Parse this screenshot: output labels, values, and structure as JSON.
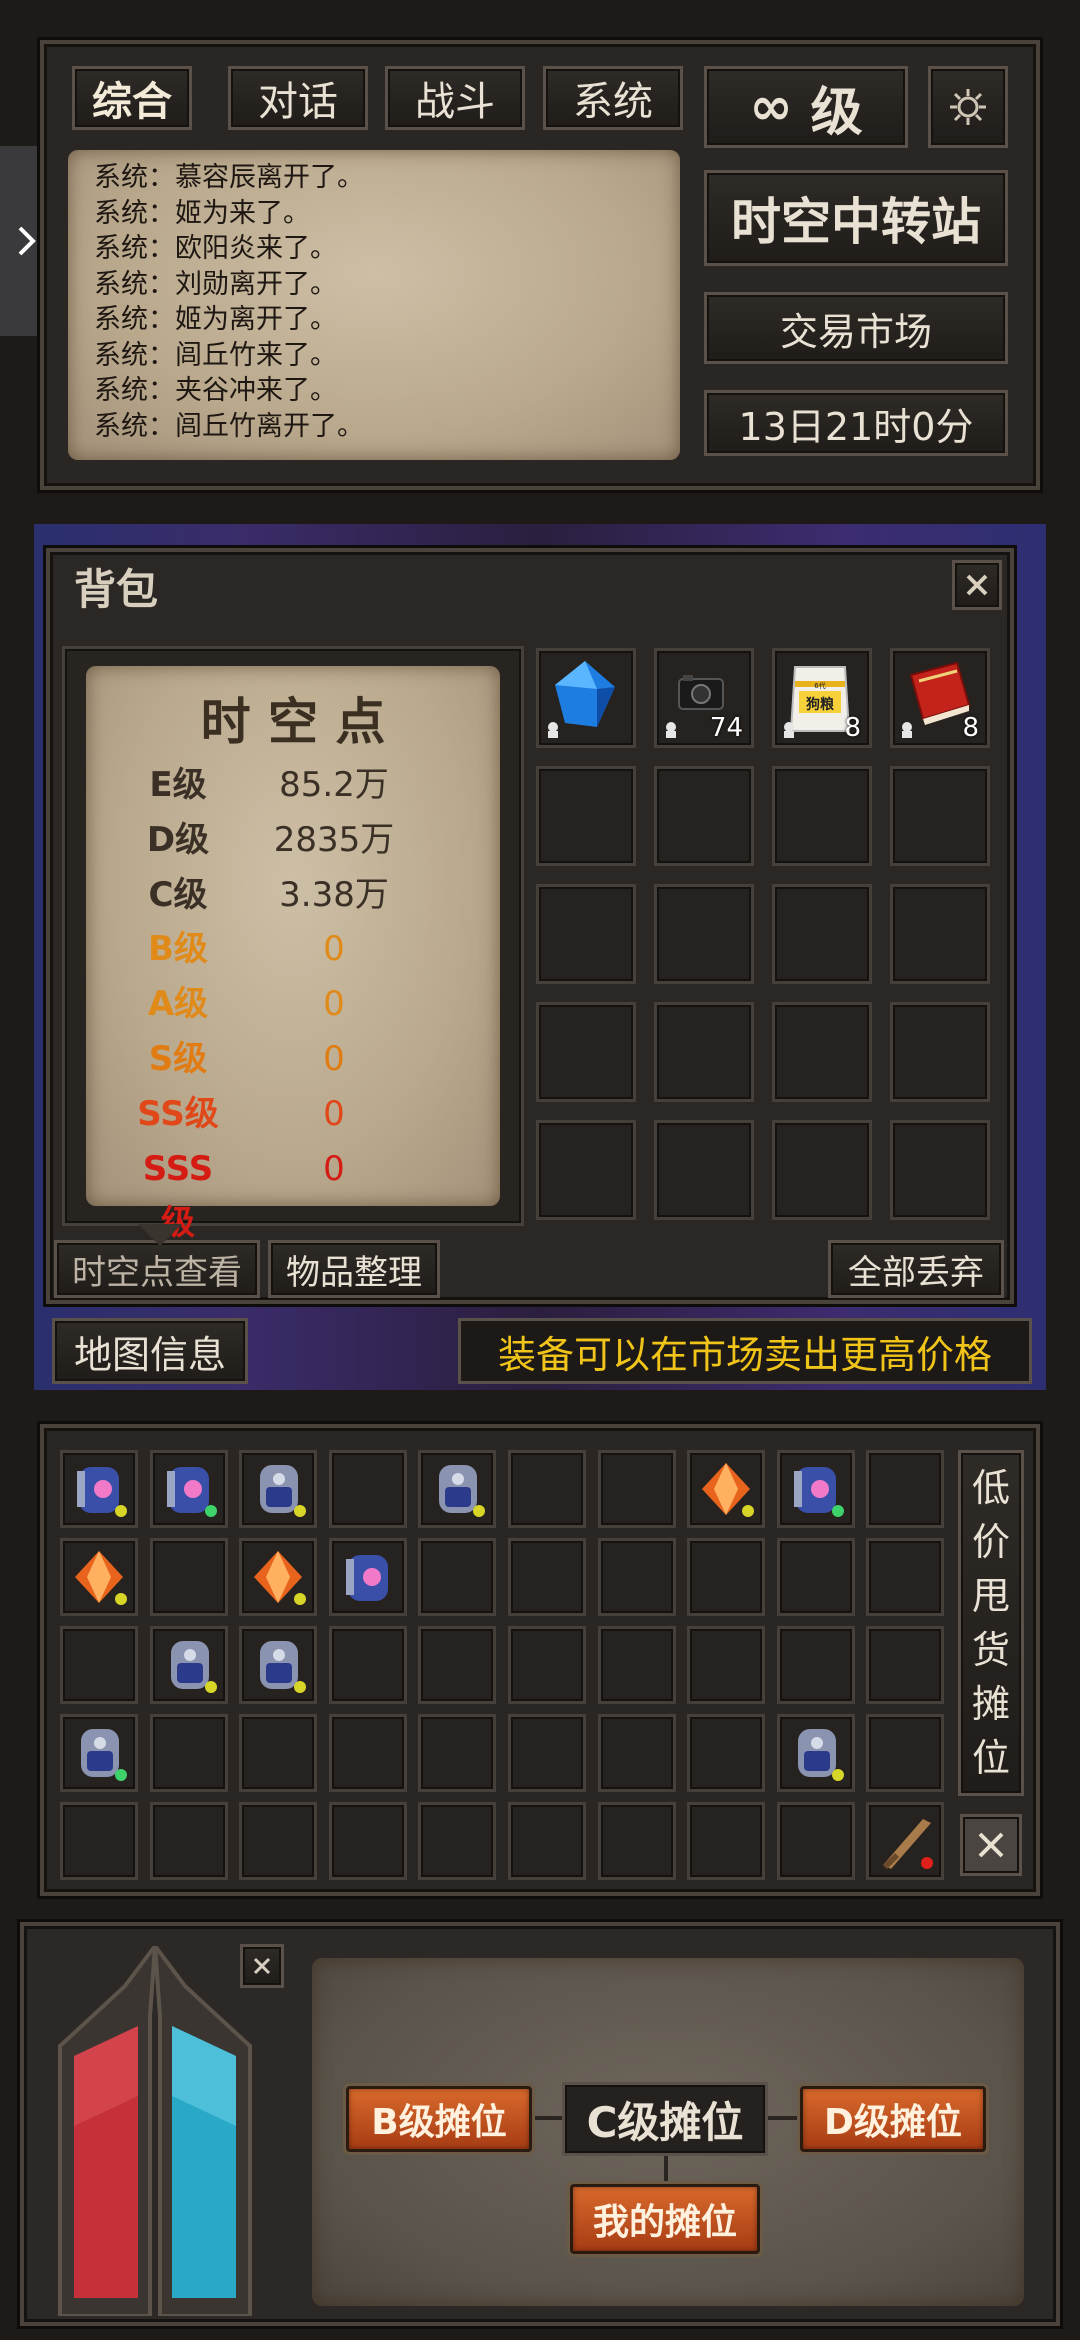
{
  "chat": {
    "tabs": [
      "综合",
      "对话",
      "战斗",
      "系统"
    ],
    "messages": [
      "系统：慕容辰离开了。",
      "系统：姬为来了。",
      "系统：欧阳炎来了。",
      "系统：刘勋离开了。",
      "系统：姬为离开了。",
      "系统：闾丘竹来了。",
      "系统：夹谷冲来了。",
      "系统：闾丘竹离开了。"
    ]
  },
  "hud": {
    "level_symbol": "∞",
    "level_label": "级",
    "location": "时空中转站",
    "market": "交易市场",
    "time": "13日21时0分"
  },
  "backpack": {
    "title": "背包",
    "points": {
      "title": "时 空 点",
      "rows": [
        {
          "grade": "E级",
          "value": "85.2万",
          "color": "#3a3026"
        },
        {
          "grade": "D级",
          "value": "2835万",
          "color": "#3a3026"
        },
        {
          "grade": "C级",
          "value": "3.38万",
          "color": "#3a3026"
        },
        {
          "grade": "B级",
          "value": "0",
          "color": "#e08a1a"
        },
        {
          "grade": "A级",
          "value": "0",
          "color": "#e08a1a"
        },
        {
          "grade": "S级",
          "value": "0",
          "color": "#e07c12"
        },
        {
          "grade": "SS级",
          "value": "0",
          "color": "#e0481a"
        },
        {
          "grade": "SSS级",
          "value": "0",
          "color": "#d41c14"
        }
      ]
    },
    "items": [
      {
        "icon": "blue-crystal-icon",
        "count": ""
      },
      {
        "icon": "camera-icon",
        "count": "74"
      },
      {
        "icon": "dog-food-bag-icon",
        "count": "8",
        "bag_text_top": "6代",
        "bag_text": "狗粮"
      },
      {
        "icon": "red-book-icon",
        "count": "8"
      }
    ],
    "buttons": {
      "view_points": "时空点查看",
      "sort": "物品整理",
      "discard_all": "全部丢弃"
    }
  },
  "map_info": "地图信息",
  "tip": "装备可以在市场卖出更高价格",
  "stall": {
    "side_label": [
      "低",
      "价",
      "甩",
      "货",
      "摊",
      "位"
    ],
    "dot_colors": {
      "green": "#3ed26a",
      "yellow": "#d7d628",
      "red": "#e0211b"
    }
  },
  "bottom": {
    "b_stall": "B级摊位",
    "c_stall": "C级摊位",
    "d_stall": "D级摊位",
    "my_stall": "我的摊位"
  },
  "colors": {
    "accent_orange": "#c4521f",
    "tip_yellow": "#f0c419",
    "hp_red": "#c5303a",
    "mp_blue": "#2aa8c8"
  }
}
